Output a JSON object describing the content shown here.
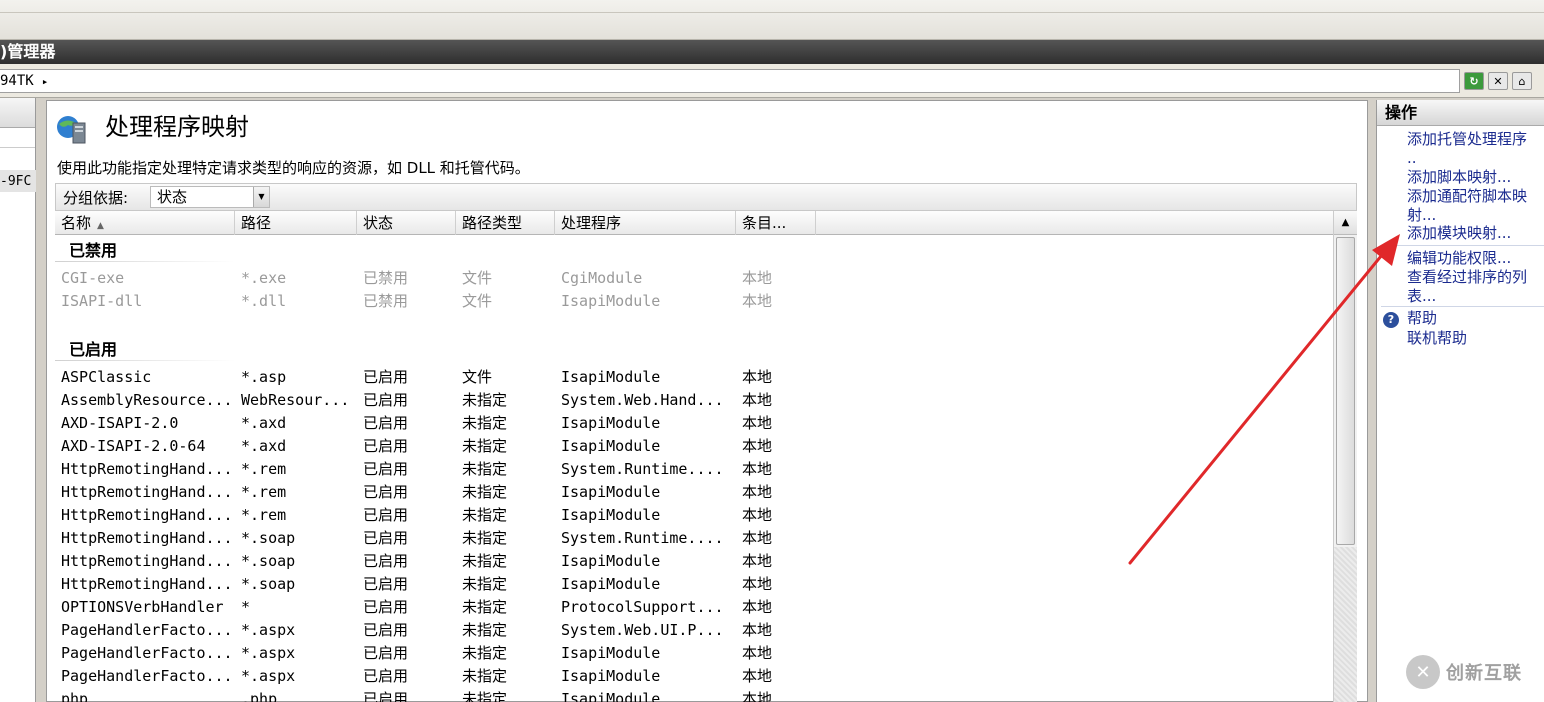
{
  "window": {
    "title": ")管理器"
  },
  "address": {
    "text": "94TK",
    "separator": "▸"
  },
  "left_tree": {
    "item": "-9FC"
  },
  "page": {
    "title": "处理程序映射",
    "description": "使用此功能指定处理特定请求类型的响应的资源，如 DLL 和托管代码。",
    "group_by_label": "分组依据:",
    "group_by_value": "状态"
  },
  "columns": [
    "名称",
    "路径",
    "状态",
    "路径类型",
    "处理程序",
    "条目..."
  ],
  "groups": [
    {
      "label": "已禁用",
      "rows": [
        [
          "CGI-exe",
          "*.exe",
          "已禁用",
          "文件",
          "CgiModule",
          "本地"
        ],
        [
          "ISAPI-dll",
          "*.dll",
          "已禁用",
          "文件",
          "IsapiModule",
          "本地"
        ]
      ]
    },
    {
      "label": "已启用",
      "rows": [
        [
          "ASPClassic",
          "*.asp",
          "已启用",
          "文件",
          "IsapiModule",
          "本地"
        ],
        [
          "AssemblyResource...",
          "WebResour...",
          "已启用",
          "未指定",
          "System.Web.Hand...",
          "本地"
        ],
        [
          "AXD-ISAPI-2.0",
          "*.axd",
          "已启用",
          "未指定",
          "IsapiModule",
          "本地"
        ],
        [
          "AXD-ISAPI-2.0-64",
          "*.axd",
          "已启用",
          "未指定",
          "IsapiModule",
          "本地"
        ],
        [
          "HttpRemotingHand...",
          "*.rem",
          "已启用",
          "未指定",
          "System.Runtime....",
          "本地"
        ],
        [
          "HttpRemotingHand...",
          "*.rem",
          "已启用",
          "未指定",
          "IsapiModule",
          "本地"
        ],
        [
          "HttpRemotingHand...",
          "*.rem",
          "已启用",
          "未指定",
          "IsapiModule",
          "本地"
        ],
        [
          "HttpRemotingHand...",
          "*.soap",
          "已启用",
          "未指定",
          "System.Runtime....",
          "本地"
        ],
        [
          "HttpRemotingHand...",
          "*.soap",
          "已启用",
          "未指定",
          "IsapiModule",
          "本地"
        ],
        [
          "HttpRemotingHand...",
          "*.soap",
          "已启用",
          "未指定",
          "IsapiModule",
          "本地"
        ],
        [
          "OPTIONSVerbHandler",
          "*",
          "已启用",
          "未指定",
          "ProtocolSupport...",
          "本地"
        ],
        [
          "PageHandlerFacto...",
          "*.aspx",
          "已启用",
          "未指定",
          "System.Web.UI.P...",
          "本地"
        ],
        [
          "PageHandlerFacto...",
          "*.aspx",
          "已启用",
          "未指定",
          "IsapiModule",
          "本地"
        ],
        [
          "PageHandlerFacto...",
          "*.aspx",
          "已启用",
          "未指定",
          "IsapiModule",
          "本地"
        ],
        [
          "php",
          ".php",
          "已启用",
          "未指定",
          "IsapiModule",
          "本地"
        ]
      ]
    }
  ],
  "actions": {
    "header": "操作",
    "links": [
      [
        "添加托管处理程序",
        ".."
      ],
      [
        "添加脚本映射..."
      ],
      [
        "添加通配符脚本映",
        "射..."
      ],
      [
        "添加模块映射..."
      ],
      [
        "编辑功能权限..."
      ],
      [
        "查看经过排序的列",
        "表..."
      ]
    ],
    "help": [
      "帮助",
      "联机帮助"
    ]
  },
  "watermark": {
    "text": "创新互联",
    "logo_glyph": "✕"
  },
  "colors": {
    "link": "#1b2b8f",
    "annotation_arrow": "#e0282a",
    "titlebar": "#3a3a3a"
  }
}
